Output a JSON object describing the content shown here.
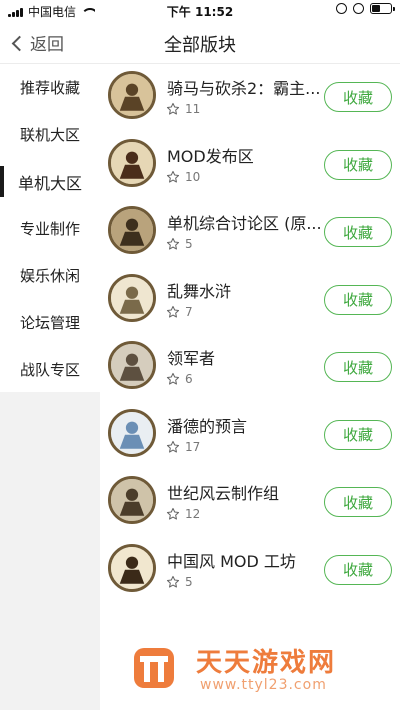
{
  "status_bar": {
    "carrier": "中国电信",
    "time": "下午 11:52"
  },
  "nav": {
    "back_label": "返回",
    "title": "全部版块"
  },
  "sidebar": {
    "items": [
      {
        "label": "推荐收藏"
      },
      {
        "label": "联机大区"
      },
      {
        "label": "单机大区"
      },
      {
        "label": "专业制作"
      },
      {
        "label": "娱乐休闲"
      },
      {
        "label": "论坛管理"
      },
      {
        "label": "战队专区"
      }
    ],
    "active_index": 2
  },
  "forums": [
    {
      "name": "骑马与砍杀2：霸主...",
      "favorites": "11",
      "button": "收藏",
      "icon": "horseman-icon"
    },
    {
      "name": "MOD发布区",
      "favorites": "10",
      "button": "收藏",
      "icon": "horseman-banner-icon"
    },
    {
      "name": "单机综合讨论区 (原...",
      "favorites": "5",
      "button": "收藏",
      "icon": "warrior-icon"
    },
    {
      "name": "乱舞水浒",
      "favorites": "7",
      "button": "收藏",
      "icon": "swordsman-icon"
    },
    {
      "name": "领军者",
      "favorites": "6",
      "button": "收藏",
      "icon": "general-icon"
    },
    {
      "name": "潘德的预言",
      "favorites": "17",
      "button": "收藏",
      "icon": "prophesy-logo-icon"
    },
    {
      "name": "世纪风云制作组",
      "favorites": "12",
      "button": "收藏",
      "icon": "group-icon"
    },
    {
      "name": "中国风 MOD 工坊",
      "favorites": "5",
      "button": "收藏",
      "icon": "seal-icon"
    }
  ],
  "watermark": {
    "title": "天天游戏网",
    "url": "www.ttyl23.com"
  },
  "colors": {
    "accent_green": "#3ea83e",
    "watermark_orange": "#ee7c3c"
  }
}
